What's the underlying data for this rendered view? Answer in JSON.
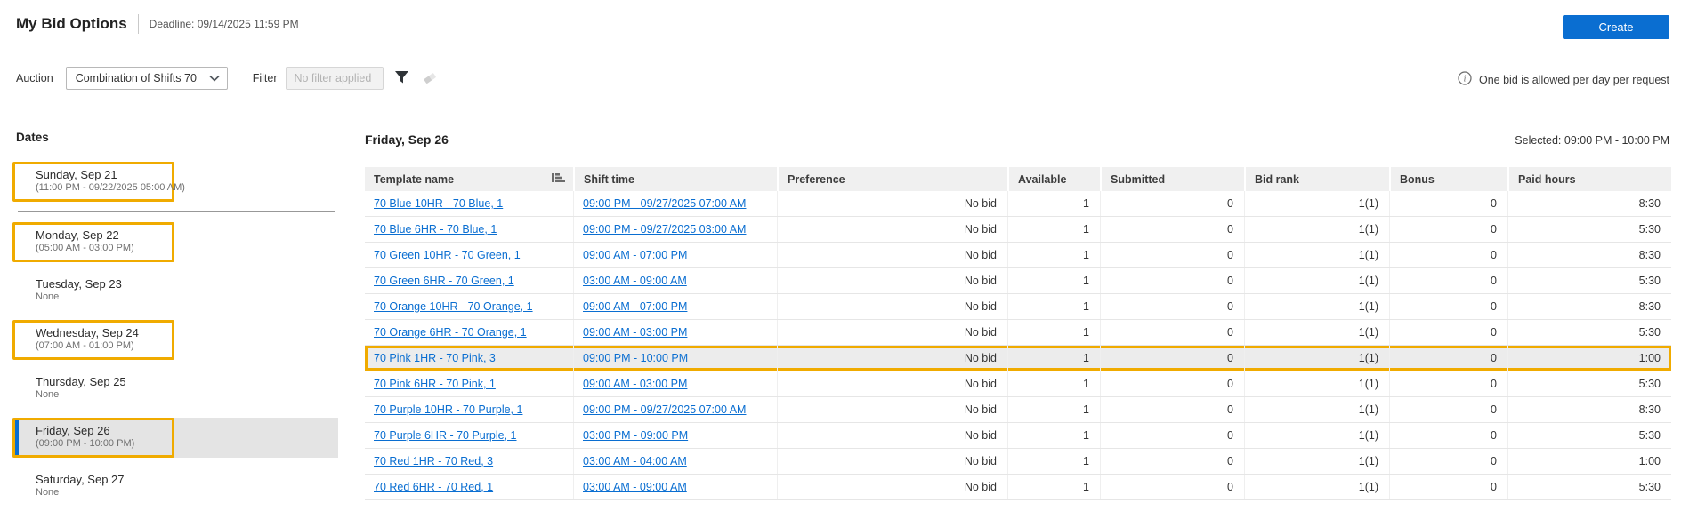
{
  "header": {
    "title": "My Bid Options",
    "deadline": "Deadline: 09/14/2025 11:59 PM",
    "create_label": "Create"
  },
  "toolbar": {
    "auction_label": "Auction",
    "auction_value": "Combination of Shifts 70",
    "filter_label": "Filter",
    "filter_placeholder": "No filter applied",
    "info_text": "One bid is allowed per day per request"
  },
  "icons": {
    "sort": "sort-descending-bars",
    "filter": "funnel",
    "clear_filter": "eraser",
    "info": "info-circle",
    "dropdown": "chevron-down"
  },
  "colors": {
    "accent_blue": "#0a6ed1",
    "link_blue": "#0a6ed1",
    "highlight_orange": "#f0ab00",
    "selected_gray": "#e4e4e4",
    "header_gray": "#f0f0f0"
  },
  "sidebar": {
    "title": "Dates",
    "items": [
      {
        "label": "Sunday, Sep 21",
        "sub": "(11:00 PM - 09/22/2025 05:00 AM)",
        "highlighted": true,
        "selected": false,
        "separator_after": true
      },
      {
        "label": "Monday, Sep 22",
        "sub": "(05:00 AM - 03:00 PM)",
        "highlighted": true,
        "selected": false,
        "separator_after": false
      },
      {
        "label": "Tuesday, Sep 23",
        "sub": "None",
        "highlighted": false,
        "selected": false,
        "separator_after": false
      },
      {
        "label": "Wednesday, Sep 24",
        "sub": "(07:00 AM - 01:00 PM)",
        "highlighted": true,
        "selected": false,
        "separator_after": false
      },
      {
        "label": "Thursday, Sep 25",
        "sub": "None",
        "highlighted": false,
        "selected": false,
        "separator_after": false
      },
      {
        "label": "Friday, Sep 26",
        "sub": "(09:00 PM - 10:00 PM)",
        "highlighted": true,
        "selected": true,
        "separator_after": false
      },
      {
        "label": "Saturday, Sep 27",
        "sub": "None",
        "highlighted": false,
        "selected": false,
        "separator_after": false
      }
    ]
  },
  "main": {
    "day_title": "Friday, Sep 26",
    "selected_text": "Selected: 09:00 PM - 10:00 PM",
    "table": {
      "columns": [
        "Template name",
        "Shift time",
        "Preference",
        "Available",
        "Submitted",
        "Bid rank",
        "Bonus",
        "Paid hours"
      ],
      "rows": [
        {
          "template": "70 Blue 10HR - 70 Blue, 1",
          "shift": "09:00 PM - 09/27/2025 07:00 AM",
          "preference": "No bid",
          "available": "1",
          "submitted": "0",
          "bid_rank": "1(1)",
          "bonus": "0",
          "paid_hours": "8:30",
          "highlighted": false
        },
        {
          "template": "70 Blue 6HR - 70 Blue, 1",
          "shift": "09:00 PM - 09/27/2025 03:00 AM",
          "preference": "No bid",
          "available": "1",
          "submitted": "0",
          "bid_rank": "1(1)",
          "bonus": "0",
          "paid_hours": "5:30",
          "highlighted": false
        },
        {
          "template": "70 Green 10HR - 70 Green, 1",
          "shift": "09:00 AM - 07:00 PM",
          "preference": "No bid",
          "available": "1",
          "submitted": "0",
          "bid_rank": "1(1)",
          "bonus": "0",
          "paid_hours": "8:30",
          "highlighted": false
        },
        {
          "template": "70 Green 6HR - 70 Green, 1",
          "shift": "03:00 AM - 09:00 AM",
          "preference": "No bid",
          "available": "1",
          "submitted": "0",
          "bid_rank": "1(1)",
          "bonus": "0",
          "paid_hours": "5:30",
          "highlighted": false
        },
        {
          "template": "70 Orange 10HR - 70 Orange, 1",
          "shift": "09:00 AM - 07:00 PM",
          "preference": "No bid",
          "available": "1",
          "submitted": "0",
          "bid_rank": "1(1)",
          "bonus": "0",
          "paid_hours": "8:30",
          "highlighted": false
        },
        {
          "template": "70 Orange 6HR - 70 Orange, 1",
          "shift": "09:00 AM - 03:00 PM",
          "preference": "No bid",
          "available": "1",
          "submitted": "0",
          "bid_rank": "1(1)",
          "bonus": "0",
          "paid_hours": "5:30",
          "highlighted": false
        },
        {
          "template": "70 Pink 1HR - 70 Pink, 3",
          "shift": "09:00 PM - 10:00 PM",
          "preference": "No bid",
          "available": "1",
          "submitted": "0",
          "bid_rank": "1(1)",
          "bonus": "0",
          "paid_hours": "1:00",
          "highlighted": true
        },
        {
          "template": "70 Pink 6HR - 70 Pink, 1",
          "shift": "09:00 AM - 03:00 PM",
          "preference": "No bid",
          "available": "1",
          "submitted": "0",
          "bid_rank": "1(1)",
          "bonus": "0",
          "paid_hours": "5:30",
          "highlighted": false
        },
        {
          "template": "70 Purple 10HR - 70 Purple, 1",
          "shift": "09:00 PM - 09/27/2025 07:00 AM",
          "preference": "No bid",
          "available": "1",
          "submitted": "0",
          "bid_rank": "1(1)",
          "bonus": "0",
          "paid_hours": "8:30",
          "highlighted": false
        },
        {
          "template": "70 Purple 6HR - 70 Purple, 1",
          "shift": "03:00 PM - 09:00 PM",
          "preference": "No bid",
          "available": "1",
          "submitted": "0",
          "bid_rank": "1(1)",
          "bonus": "0",
          "paid_hours": "5:30",
          "highlighted": false
        },
        {
          "template": "70 Red 1HR - 70 Red, 3",
          "shift": "03:00 AM - 04:00 AM",
          "preference": "No bid",
          "available": "1",
          "submitted": "0",
          "bid_rank": "1(1)",
          "bonus": "0",
          "paid_hours": "1:00",
          "highlighted": false
        },
        {
          "template": "70 Red 6HR - 70 Red, 1",
          "shift": "03:00 AM - 09:00 AM",
          "preference": "No bid",
          "available": "1",
          "submitted": "0",
          "bid_rank": "1(1)",
          "bonus": "0",
          "paid_hours": "5:30",
          "highlighted": false
        }
      ]
    }
  }
}
